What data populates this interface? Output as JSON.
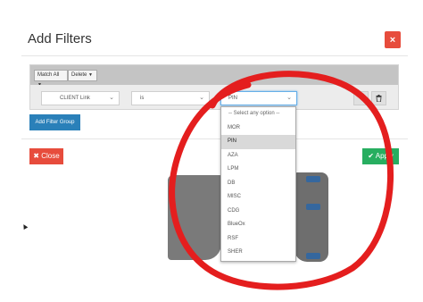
{
  "modal": {
    "title": "Add Filters",
    "close_icon": "×",
    "close_button": {
      "icon": "close-x-icon",
      "label": "Close"
    },
    "apply_button": {
      "icon": "check-icon",
      "label": "Apply"
    }
  },
  "group": {
    "match_all": "Match All",
    "delete": "Delete",
    "condition": {
      "field_value": "CLIENT Link",
      "operator_value": "is",
      "value_selected": "PIN"
    },
    "add_filter_group": "Add Filter Group"
  },
  "dropdown": {
    "options": [
      "-- Select any option --",
      "MOR",
      "PIN",
      "AZA",
      "LPM",
      "DB",
      "MISC",
      "CDG",
      "BlueOx",
      "RSF",
      "SHER"
    ],
    "selected": "PIN"
  },
  "colors": {
    "danger": "#e74c3c",
    "success": "#27ae60",
    "primary": "#2a80b9",
    "annotation": "#e41e1e"
  }
}
